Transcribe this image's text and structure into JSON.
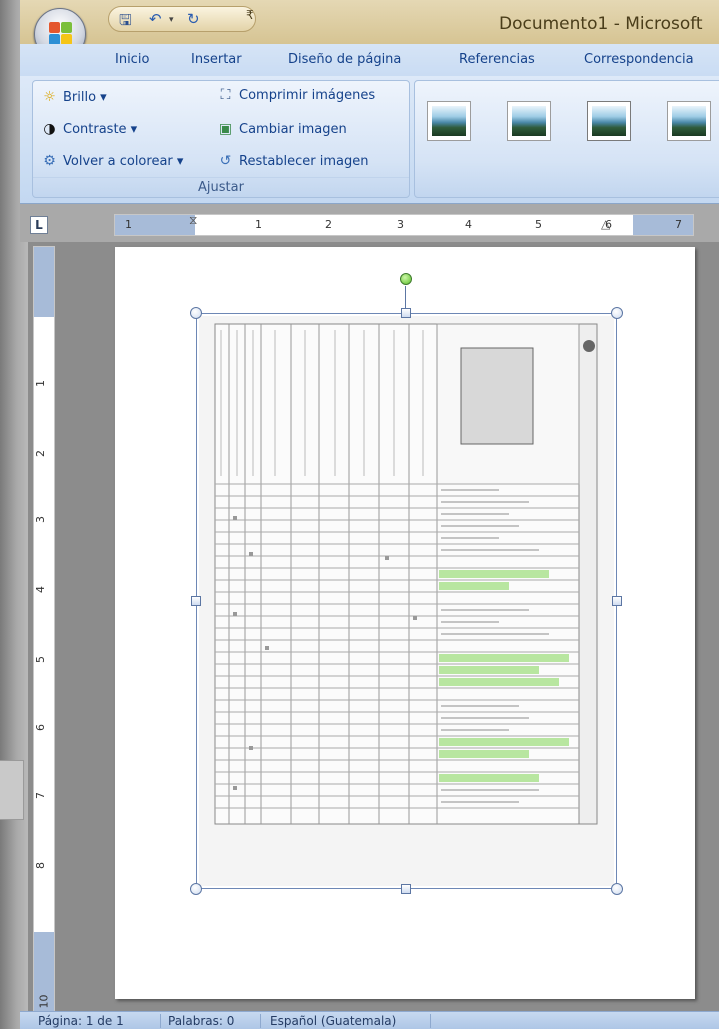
{
  "window": {
    "title": "Documento1 - Microsoft"
  },
  "quick_access": {
    "save_icon": "save-icon",
    "undo_icon": "undo-icon",
    "redo_icon": "redo-icon",
    "dropdown_glyph": "▾",
    "customize_glyph": "₹"
  },
  "ribbon_tabs": [
    {
      "label": "Inicio"
    },
    {
      "label": "Insertar"
    },
    {
      "label": "Diseño de página"
    },
    {
      "label": "Referencias"
    },
    {
      "label": "Correspondencia"
    }
  ],
  "ajustar": {
    "group_label": "Ajustar",
    "brillo": "Brillo ▾",
    "contraste": "Contraste ▾",
    "volver_colorear": "Volver a colorear ▾",
    "comprimir": "Comprimir imágenes",
    "cambiar": "Cambiar imagen",
    "restablecer": "Restablecer imagen"
  },
  "styles_gallery": {
    "thumbnails": 4
  },
  "ruler": {
    "tab_selector": "L",
    "h_numbers": [
      "1",
      "1",
      "2",
      "3",
      "4",
      "5",
      "6",
      "7"
    ],
    "v_numbers": [
      "1",
      "2",
      "3",
      "4",
      "5",
      "6",
      "7",
      "8",
      "10"
    ]
  },
  "status": {
    "page": "Página: 1 de 1",
    "words": "Palabras: 0",
    "language": "Español (Guatemala)"
  },
  "colors": {
    "ribbon_blue": "#c9dcf3",
    "title_gold": "#d6c493",
    "accent_text": "#15428b"
  }
}
